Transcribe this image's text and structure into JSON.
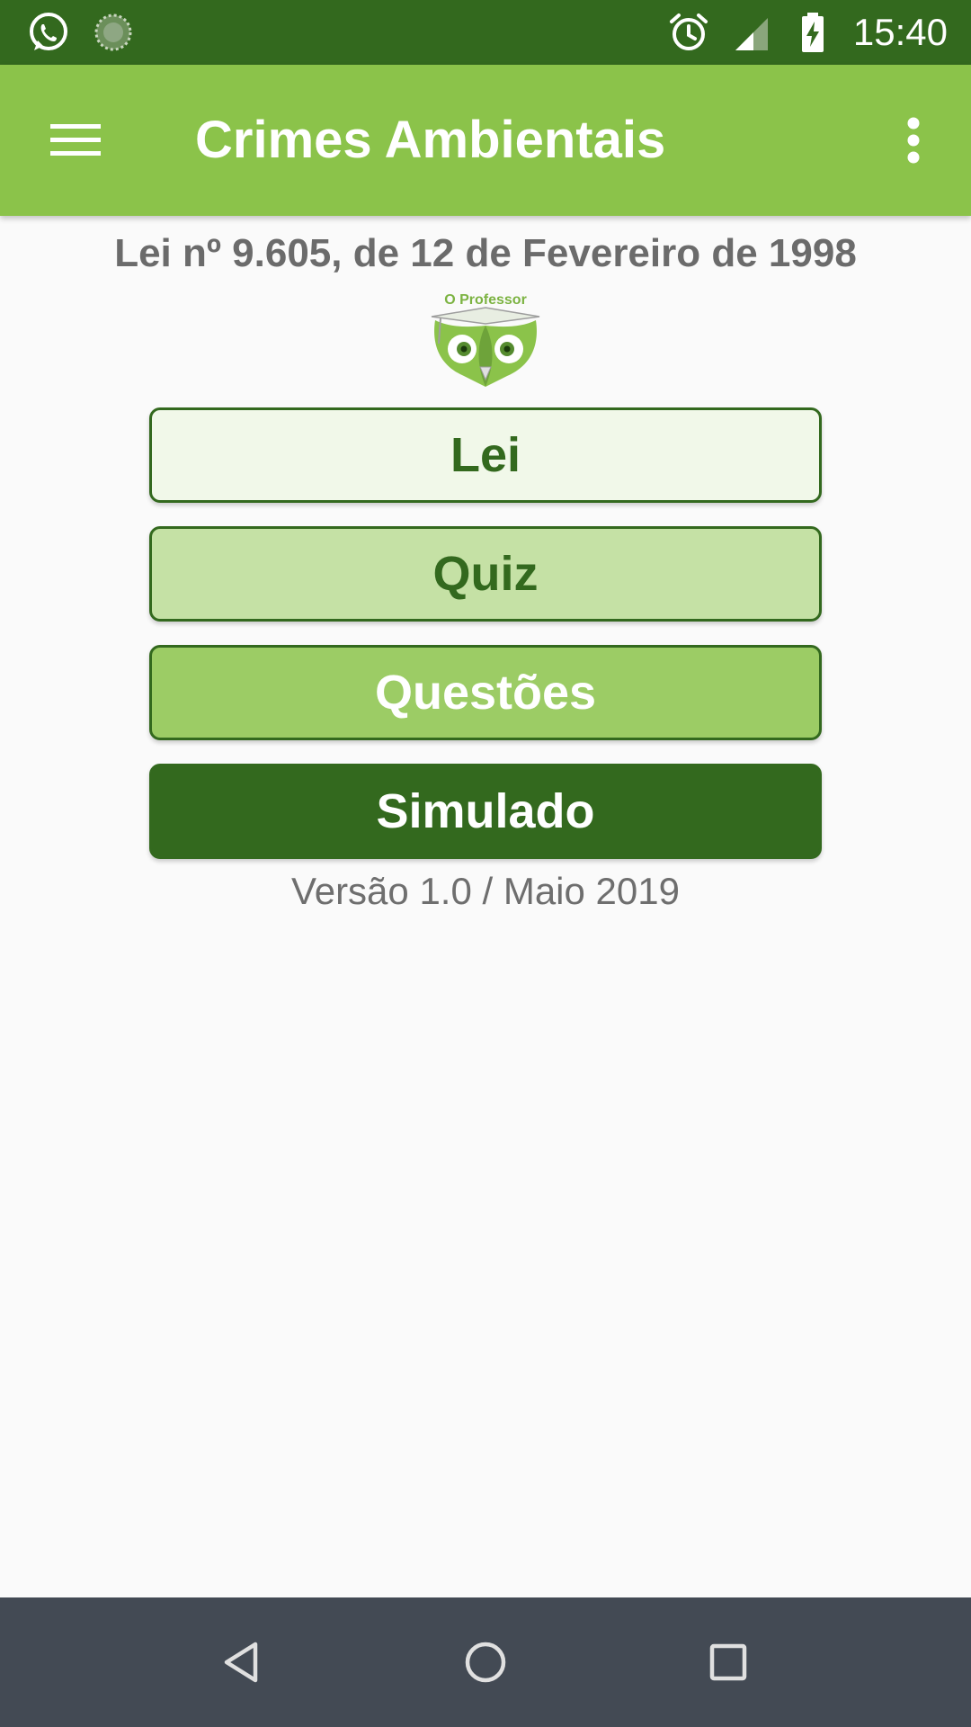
{
  "status_bar": {
    "time": "15:40",
    "icons": [
      "whatsapp-icon",
      "sync-icon",
      "alarm-icon",
      "signal-icon",
      "battery-charging-icon"
    ]
  },
  "app_bar": {
    "title": "Crimes Ambientais",
    "menu_icon": "hamburger-menu-icon",
    "overflow_icon": "more-vert-icon"
  },
  "main": {
    "law_title": "Lei nº 9.605, de 12 de Fevereiro de 1998",
    "logo_text": "O Professor",
    "buttons": {
      "lei": "Lei",
      "quiz": "Quiz",
      "questoes": "Questões",
      "simulado": "Simulado"
    },
    "version": "Versão 1.0 / Maio 2019"
  },
  "nav_bar": {
    "icons": [
      "back-icon",
      "home-icon",
      "recents-icon"
    ]
  },
  "colors": {
    "primary_dark": "#33691e",
    "primary": "#8bc34a",
    "btn_lei_bg": "#f1f8e9",
    "btn_quiz_bg": "#c5e1a5",
    "btn_questoes_bg": "#9ccc65",
    "btn_simulado_bg": "#33691e",
    "nav_bar": "#434a54"
  }
}
